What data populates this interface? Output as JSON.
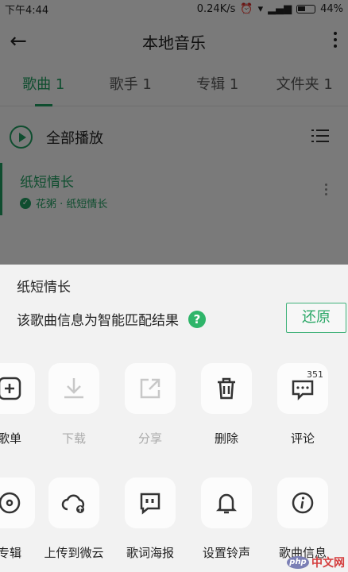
{
  "status": {
    "time": "下午4:44",
    "speed": "0.24K/s",
    "battery": "44%"
  },
  "appbar": {
    "title": "本地音乐"
  },
  "tabs": [
    {
      "label": "歌曲 1",
      "active": true
    },
    {
      "label": "歌手 1",
      "active": false
    },
    {
      "label": "专辑 1",
      "active": false
    },
    {
      "label": "文件夹 1",
      "active": false
    }
  ],
  "playall": {
    "label": "全部播放"
  },
  "song": {
    "title": "纸短情长",
    "meta": "花粥 · 纸短情长"
  },
  "sheet": {
    "title": "纸短情长",
    "info": "该歌曲信息为智能匹配结果",
    "help": "?",
    "restore": "还原",
    "row1": [
      {
        "icon": "add-to-playlist-icon",
        "label": "歌单",
        "enabled": true
      },
      {
        "icon": "download-icon",
        "label": "下载",
        "enabled": false
      },
      {
        "icon": "share-icon",
        "label": "分享",
        "enabled": false
      },
      {
        "icon": "trash-icon",
        "label": "删除",
        "enabled": true
      },
      {
        "icon": "comment-icon",
        "label": "评论",
        "enabled": true,
        "badge": "351"
      }
    ],
    "row2": [
      {
        "icon": "album-icon",
        "label": "专辑",
        "enabled": true
      },
      {
        "icon": "cloud-upload-icon",
        "label": "上传到微云",
        "enabled": true
      },
      {
        "icon": "lyric-poster-icon",
        "label": "歌词海报",
        "enabled": true
      },
      {
        "icon": "bell-icon",
        "label": "设置铃声",
        "enabled": true
      },
      {
        "icon": "info-icon",
        "label": "歌曲信息",
        "enabled": true
      }
    ]
  },
  "watermark": {
    "logo": "php",
    "text": "中文网"
  },
  "colors": {
    "accent": "#1e9b5e",
    "sheet_bg": "#f2f2f2"
  }
}
